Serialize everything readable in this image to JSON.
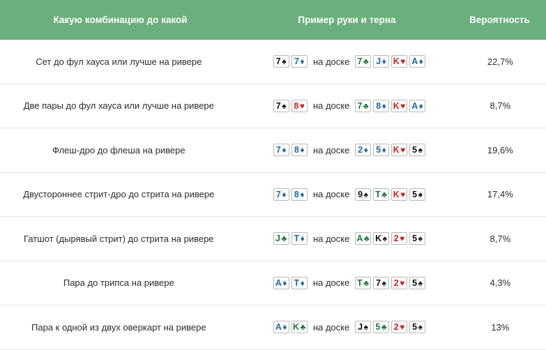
{
  "header": {
    "col1": "Какую комбинацию до какой",
    "col2": "Пример руки и терна",
    "col3": "Вероятность"
  },
  "colors": {
    "spades": "#111111",
    "hearts": "#d21f1f",
    "diamonds": "#1f6aa5",
    "clubs": "#1a7a3b",
    "header_bg": "#6aaf7d"
  },
  "on_board": "на доске",
  "rows": [
    {
      "desc": "Сет до фул хауса или лучше на ривере",
      "prob": "22,7%",
      "hand": [
        {
          "rank": "7",
          "suit": "s"
        },
        {
          "rank": "7",
          "suit": "d"
        }
      ],
      "board": [
        {
          "rank": "7",
          "suit": "c"
        },
        {
          "rank": "J",
          "suit": "d"
        },
        {
          "rank": "K",
          "suit": "h"
        },
        {
          "rank": "A",
          "suit": "d"
        }
      ]
    },
    {
      "desc": "Две пары до фул хауса или лучше на ривере",
      "prob": "8,7%",
      "hand": [
        {
          "rank": "7",
          "suit": "s"
        },
        {
          "rank": "8",
          "suit": "h"
        }
      ],
      "board": [
        {
          "rank": "7",
          "suit": "c"
        },
        {
          "rank": "8",
          "suit": "d"
        },
        {
          "rank": "K",
          "suit": "h"
        },
        {
          "rank": "A",
          "suit": "d"
        }
      ]
    },
    {
      "desc": "Флеш-дро до флеша на ривере",
      "prob": "19,6%",
      "hand": [
        {
          "rank": "7",
          "suit": "d"
        },
        {
          "rank": "8",
          "suit": "d"
        }
      ],
      "board": [
        {
          "rank": "2",
          "suit": "d"
        },
        {
          "rank": "5",
          "suit": "d"
        },
        {
          "rank": "K",
          "suit": "h"
        },
        {
          "rank": "5",
          "suit": "s"
        }
      ]
    },
    {
      "desc": "Двустороннее стрит-дро до стрита на ривере",
      "prob": "17,4%",
      "hand": [
        {
          "rank": "7",
          "suit": "d"
        },
        {
          "rank": "8",
          "suit": "d"
        }
      ],
      "board": [
        {
          "rank": "9",
          "suit": "s"
        },
        {
          "rank": "T",
          "suit": "c"
        },
        {
          "rank": "K",
          "suit": "h"
        },
        {
          "rank": "5",
          "suit": "s"
        }
      ]
    },
    {
      "desc": "Гатшот (дырявый стрит) до стрита на ривере",
      "prob": "8,7%",
      "hand": [
        {
          "rank": "J",
          "suit": "c"
        },
        {
          "rank": "T",
          "suit": "d"
        }
      ],
      "board": [
        {
          "rank": "A",
          "suit": "c"
        },
        {
          "rank": "K",
          "suit": "s"
        },
        {
          "rank": "2",
          "suit": "h"
        },
        {
          "rank": "5",
          "suit": "s"
        }
      ]
    },
    {
      "desc": "Пара до трипса на ривере",
      "prob": "4,3%",
      "hand": [
        {
          "rank": "A",
          "suit": "d"
        },
        {
          "rank": "T",
          "suit": "d"
        }
      ],
      "board": [
        {
          "rank": "T",
          "suit": "c"
        },
        {
          "rank": "7",
          "suit": "s"
        },
        {
          "rank": "2",
          "suit": "h"
        },
        {
          "rank": "5",
          "suit": "s"
        }
      ]
    },
    {
      "desc": "Пара к одной из двух оверкарт на ривере",
      "prob": "13%",
      "hand": [
        {
          "rank": "A",
          "suit": "d"
        },
        {
          "rank": "K",
          "suit": "c"
        }
      ],
      "board": [
        {
          "rank": "J",
          "suit": "s"
        },
        {
          "rank": "5",
          "suit": "c"
        },
        {
          "rank": "2",
          "suit": "h"
        },
        {
          "rank": "5",
          "suit": "s"
        }
      ]
    }
  ]
}
